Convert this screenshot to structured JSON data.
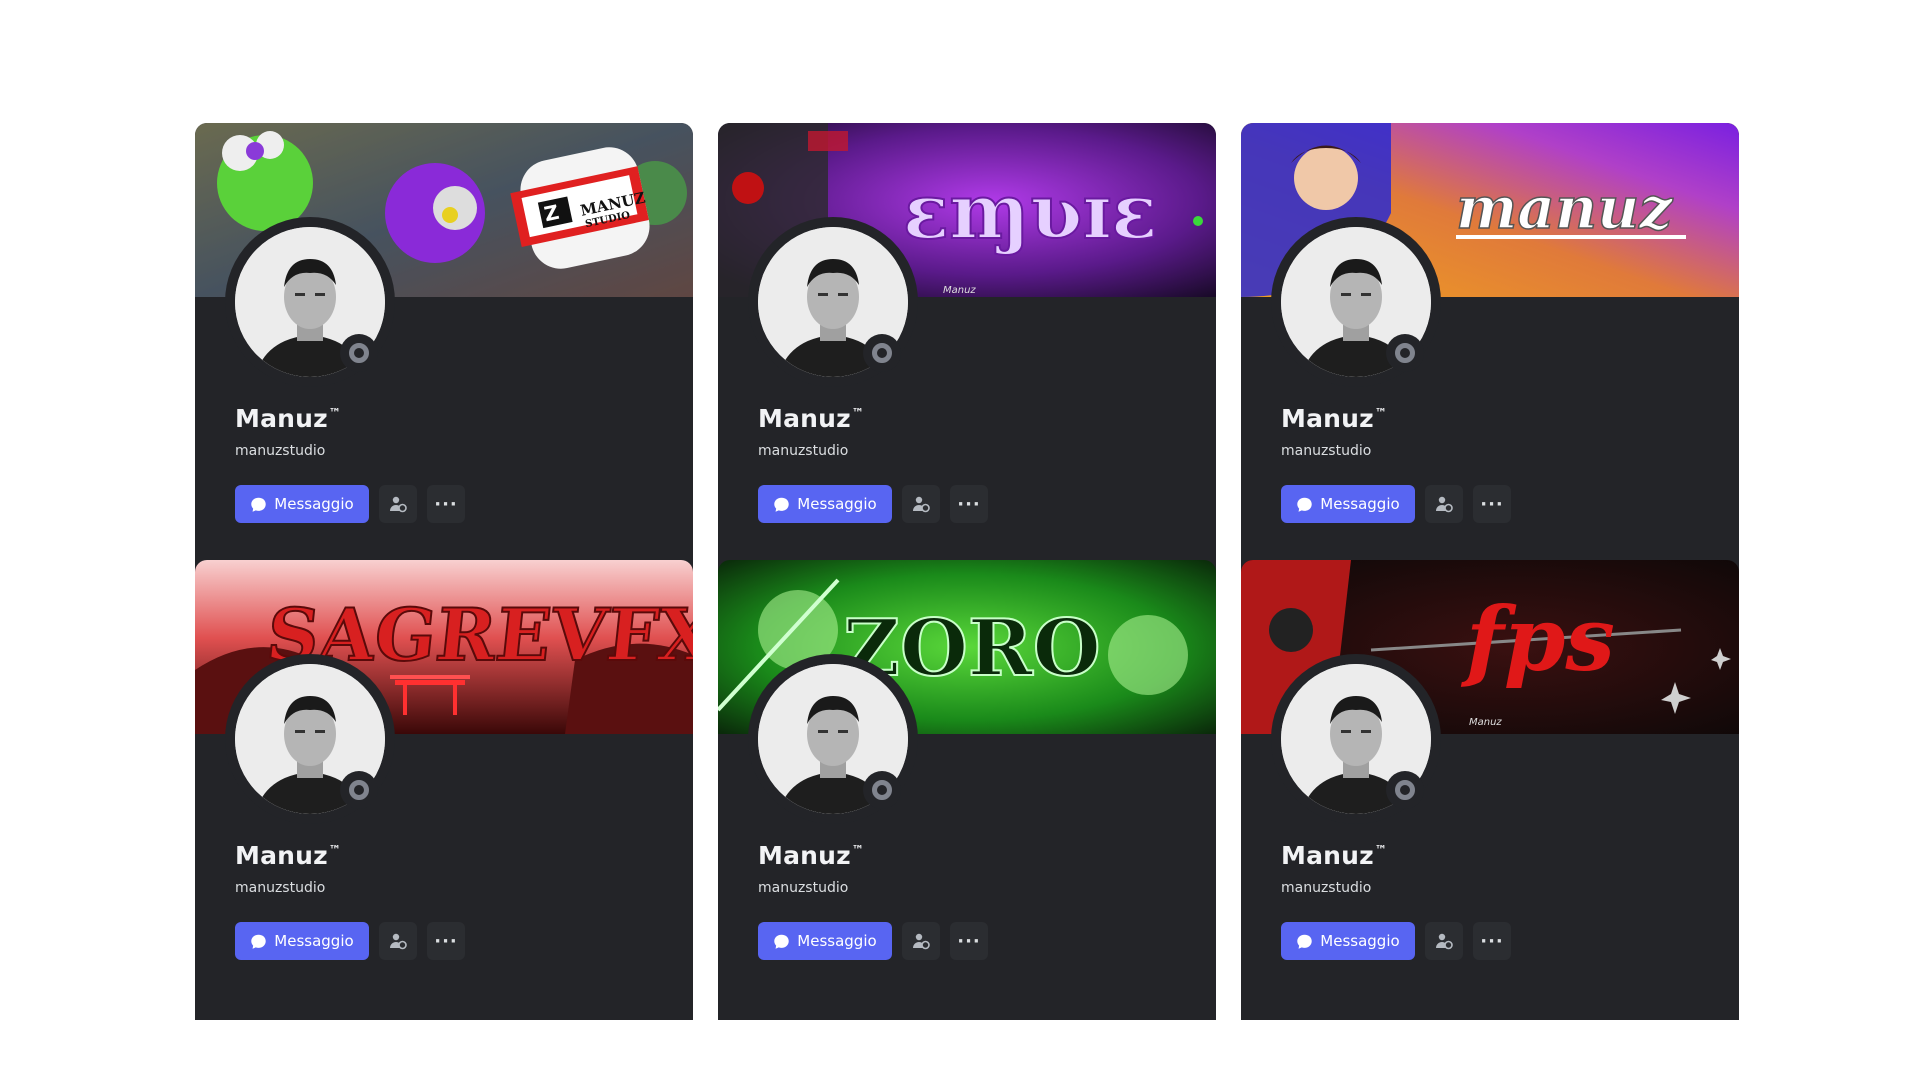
{
  "profiles": [
    {
      "display_name": "Manuz",
      "trademark": "™",
      "username": "manuzstudio",
      "message_label": "Messaggio",
      "more_label": "···",
      "banner_text": "MANUZ",
      "banner_subtext": "STUDIO",
      "banner_theme": "graffiti",
      "status_icon": "offline-status-icon"
    },
    {
      "display_name": "Manuz",
      "trademark": "™",
      "username": "manuzstudio",
      "message_label": "Messaggio",
      "more_label": "···",
      "banner_text": "ɛɱʋɪɛ",
      "banner_subtext": "Manuz",
      "banner_theme": "purple",
      "status_icon": "offline-status-icon"
    },
    {
      "display_name": "Manuz",
      "trademark": "™",
      "username": "manuzstudio",
      "message_label": "Messaggio",
      "more_label": "···",
      "banner_text": "manuz",
      "banner_subtext": "",
      "banner_theme": "gradient",
      "status_icon": "offline-status-icon"
    },
    {
      "display_name": "Manuz",
      "trademark": "™",
      "username": "manuzstudio",
      "message_label": "Messaggio",
      "more_label": "···",
      "banner_text": "SAGREVFX",
      "banner_subtext": "",
      "banner_theme": "red-torii",
      "status_icon": "offline-status-icon"
    },
    {
      "display_name": "Manuz",
      "trademark": "™",
      "username": "manuzstudio",
      "message_label": "Messaggio",
      "more_label": "···",
      "banner_text": "ZORO",
      "banner_subtext": "",
      "banner_theme": "green",
      "status_icon": "offline-status-icon"
    },
    {
      "display_name": "Manuz",
      "trademark": "™",
      "username": "manuzstudio",
      "message_label": "Messaggio",
      "more_label": "···",
      "banner_text": "fps",
      "banner_subtext": "Manuz",
      "banner_theme": "dark-red",
      "status_icon": "offline-status-icon"
    }
  ],
  "colors": {
    "card_bg": "#232428",
    "button_blurple": "#5865f2",
    "icon_button_bg": "#2b2d31",
    "text_primary": "#f2f3f5",
    "status_offline": "#80848e"
  }
}
